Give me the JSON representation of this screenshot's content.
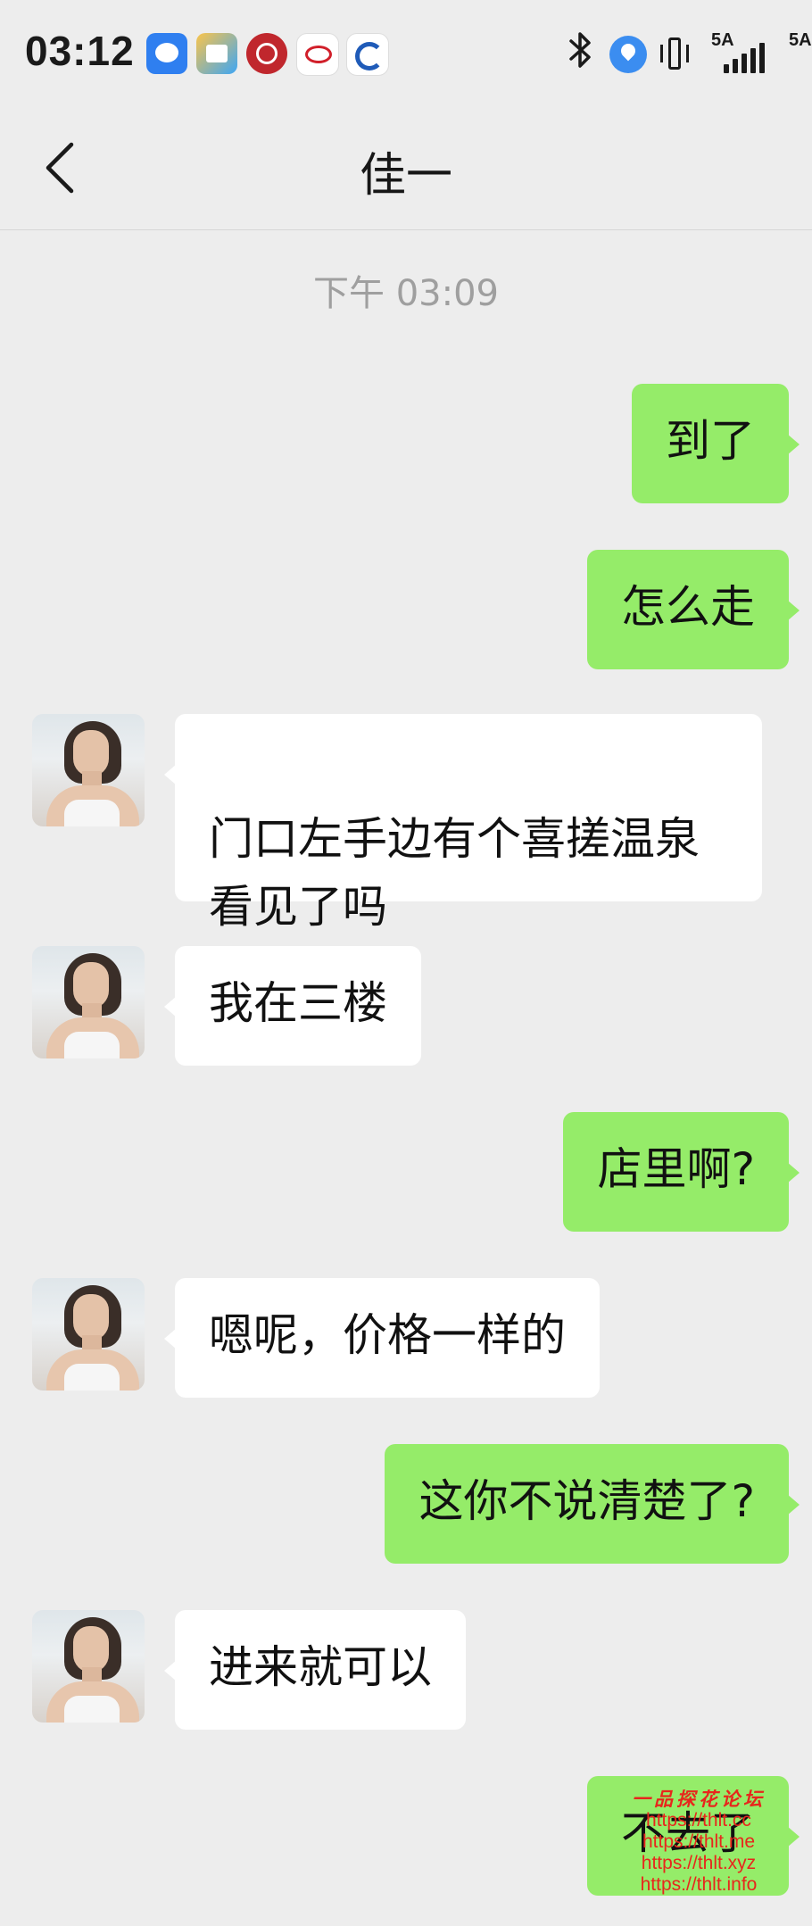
{
  "status_bar": {
    "time": "03:12",
    "network_primary": "5A",
    "network_secondary": "5A",
    "notification_icons": [
      "chat-bubble-icon",
      "mail-app-icon",
      "bank-app-icon",
      "toyota-app-icon",
      "crescent-app-icon"
    ],
    "system_icons": [
      "bluetooth-icon",
      "location-icon",
      "vibrate-icon",
      "signal-icon"
    ]
  },
  "header": {
    "title": "佳一"
  },
  "timestamp": "下午 03:09",
  "messages": [
    {
      "sender": "me",
      "text": "到了"
    },
    {
      "sender": "me",
      "text": "怎么走"
    },
    {
      "sender": "them",
      "text": "门口左手边有个喜搓温泉\n看见了吗"
    },
    {
      "sender": "them",
      "text": "我在三楼"
    },
    {
      "sender": "me",
      "text": "店里啊?"
    },
    {
      "sender": "them",
      "text": "嗯呢，价格一样的"
    },
    {
      "sender": "me",
      "text": "这你不说清楚了?"
    },
    {
      "sender": "them",
      "text": "进来就可以"
    },
    {
      "sender": "me",
      "text": "不去了"
    }
  ],
  "watermark": {
    "title": "一品探花论坛",
    "urls": [
      "https://thlt.cc",
      "https://thlt.me",
      "https://thlt.xyz",
      "https://thlt.info"
    ]
  },
  "colors": {
    "background": "#ededed",
    "my_bubble": "#95ec69",
    "their_bubble": "#ffffff",
    "timestamp_text": "#9f9f9f",
    "watermark": "#e8261c"
  }
}
